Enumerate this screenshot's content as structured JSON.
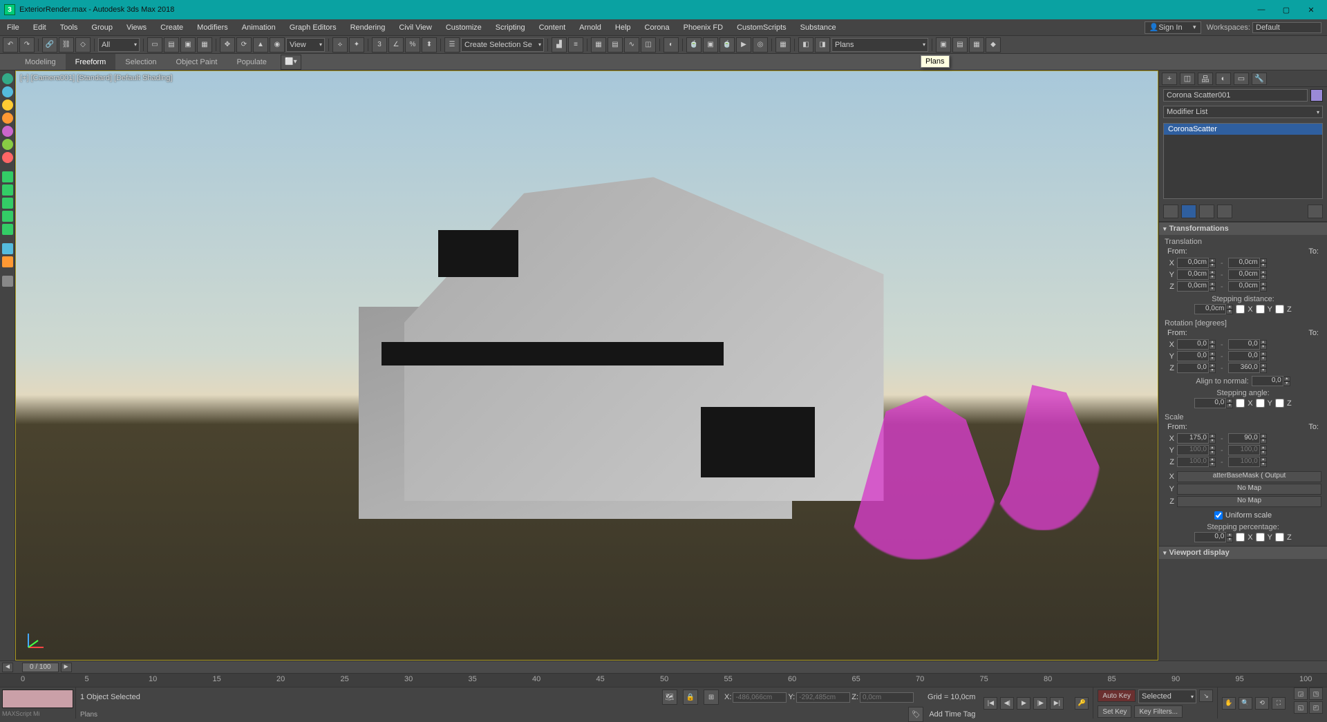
{
  "window": {
    "title": "ExteriorRender.max - Autodesk 3ds Max 2018",
    "signin": "Sign In",
    "workspaces_label": "Workspaces:",
    "workspaces_value": "Default"
  },
  "menu": [
    "File",
    "Edit",
    "Tools",
    "Group",
    "Views",
    "Create",
    "Modifiers",
    "Animation",
    "Graph Editors",
    "Rendering",
    "Civil View",
    "Customize",
    "Scripting",
    "Content",
    "Arnold",
    "Help",
    "Corona",
    "Phoenix FD",
    "CustomScripts",
    "Substance"
  ],
  "toolbar": {
    "sel_all": "All",
    "view": "View",
    "create_set": "Create Selection Se",
    "plans": "Plans"
  },
  "tooltip": "Plans",
  "ribbon": [
    "Modeling",
    "Freeform",
    "Selection",
    "Object Paint",
    "Populate"
  ],
  "ribbon_active": 1,
  "viewport": {
    "corner": "[+] [Camera001] [Standard] [Default Shading]"
  },
  "cmd": {
    "objname": "Corona Scatter001",
    "modlist_label": "Modifier List",
    "stack_item": "CoronaScatter",
    "rollout_transforms": "Transformations",
    "translation": "Translation",
    "from": "From:",
    "to": "To:",
    "trans": {
      "x_from": "0,0cm",
      "x_to": "0,0cm",
      "y_from": "0,0cm",
      "y_to": "0,0cm",
      "z_from": "0,0cm",
      "z_to": "0,0cm"
    },
    "step_dist_label": "Stepping distance:",
    "step_dist": "0,0cm",
    "rotation_label": "Rotation [degrees]",
    "rot": {
      "x_from": "0,0",
      "x_to": "0,0",
      "y_from": "0,0",
      "y_to": "0,0",
      "z_from": "0,0",
      "z_to": "360,0"
    },
    "align_normal_label": "Align to normal:",
    "align_normal": "0,0",
    "step_angle_label": "Stepping angle:",
    "step_angle": "0,0",
    "scale_label": "Scale",
    "scale": {
      "x_from": "175,0",
      "x_to": "90,0",
      "y_from": "100,0",
      "y_to": "100,0",
      "z_from": "100,0",
      "z_to": "100,0"
    },
    "map_x": "atterBaseMask  ( Output",
    "map_y": "No Map",
    "map_z": "No Map",
    "uniform_scale": "Uniform scale",
    "step_pct_label": "Stepping percentage:",
    "step_pct": "0,0",
    "viewport_display": "Viewport display",
    "axes": {
      "x": "X",
      "y": "Y",
      "z": "Z"
    }
  },
  "time": {
    "frame": "0 / 100",
    "marks": [
      0,
      5,
      10,
      15,
      20,
      25,
      30,
      35,
      40,
      45,
      50,
      55,
      60,
      65,
      70,
      75,
      80,
      85,
      90,
      95,
      100
    ]
  },
  "status": {
    "selected": "1 Object Selected",
    "plans": "Plans",
    "ms": "MAXScript Mi",
    "x_label": "X:",
    "y_label": "Y:",
    "z_label": "Z:",
    "x": "-486,066cm",
    "y": "-292,485cm",
    "z": "0,0cm",
    "grid": "Grid = 10,0cm",
    "addtag": "Add Time Tag",
    "autokey": "Auto Key",
    "selected_filter": "Selected",
    "setkey": "Set Key",
    "keyfilters": "Key Filters..."
  }
}
